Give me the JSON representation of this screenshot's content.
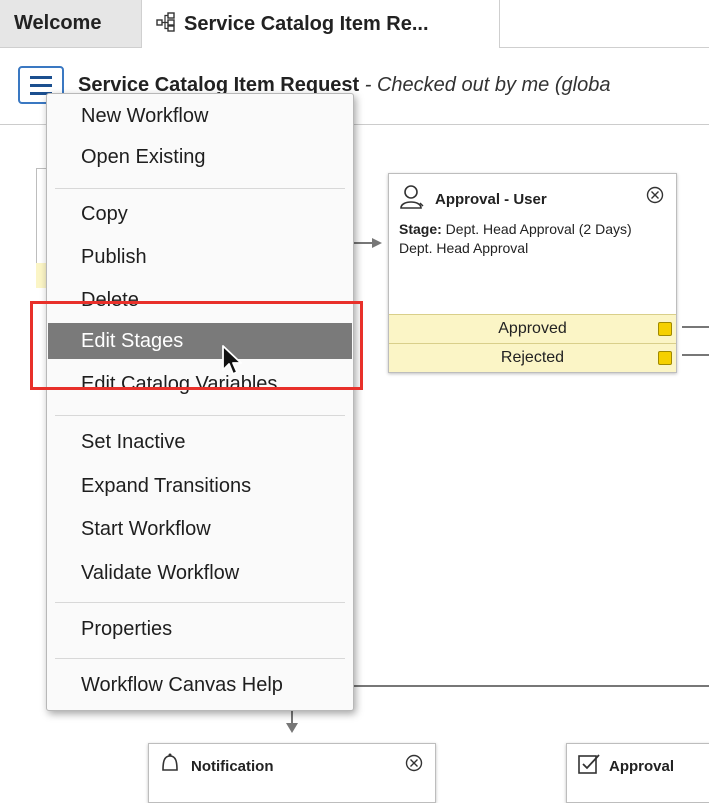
{
  "tabs": {
    "welcome": "Welcome",
    "active": "Service Catalog Item Re..."
  },
  "header": {
    "title": "Service Catalog Item Request",
    "status": " - Checked out by me  (globa"
  },
  "menu": {
    "items": [
      "New Workflow",
      "Open Existing",
      "Copy",
      "Publish",
      "Delete",
      "Edit Stages",
      "Edit Catalog Variables",
      "Set Inactive",
      "Expand Transitions",
      "Start Workflow",
      "Validate Workflow",
      "Properties",
      "Workflow Canvas Help"
    ],
    "highlighted": "Edit Stages"
  },
  "activity_approval": {
    "title": "Approval - User",
    "stage_label": "Stage:",
    "stage_value": " Dept. Head Approval (2 Days)",
    "description": "Dept. Head Approval",
    "transitions": [
      "Approved",
      "Rejected"
    ]
  },
  "activity_notification": {
    "title": "Notification"
  },
  "activity_approval2": {
    "title": "Approval"
  },
  "colors": {
    "accent": "#3a78c2",
    "highlight_box": "#e8302a",
    "menu_hover": "#7a7a7a",
    "transition_bg": "#fbf5c6",
    "port": "#f5d000"
  }
}
